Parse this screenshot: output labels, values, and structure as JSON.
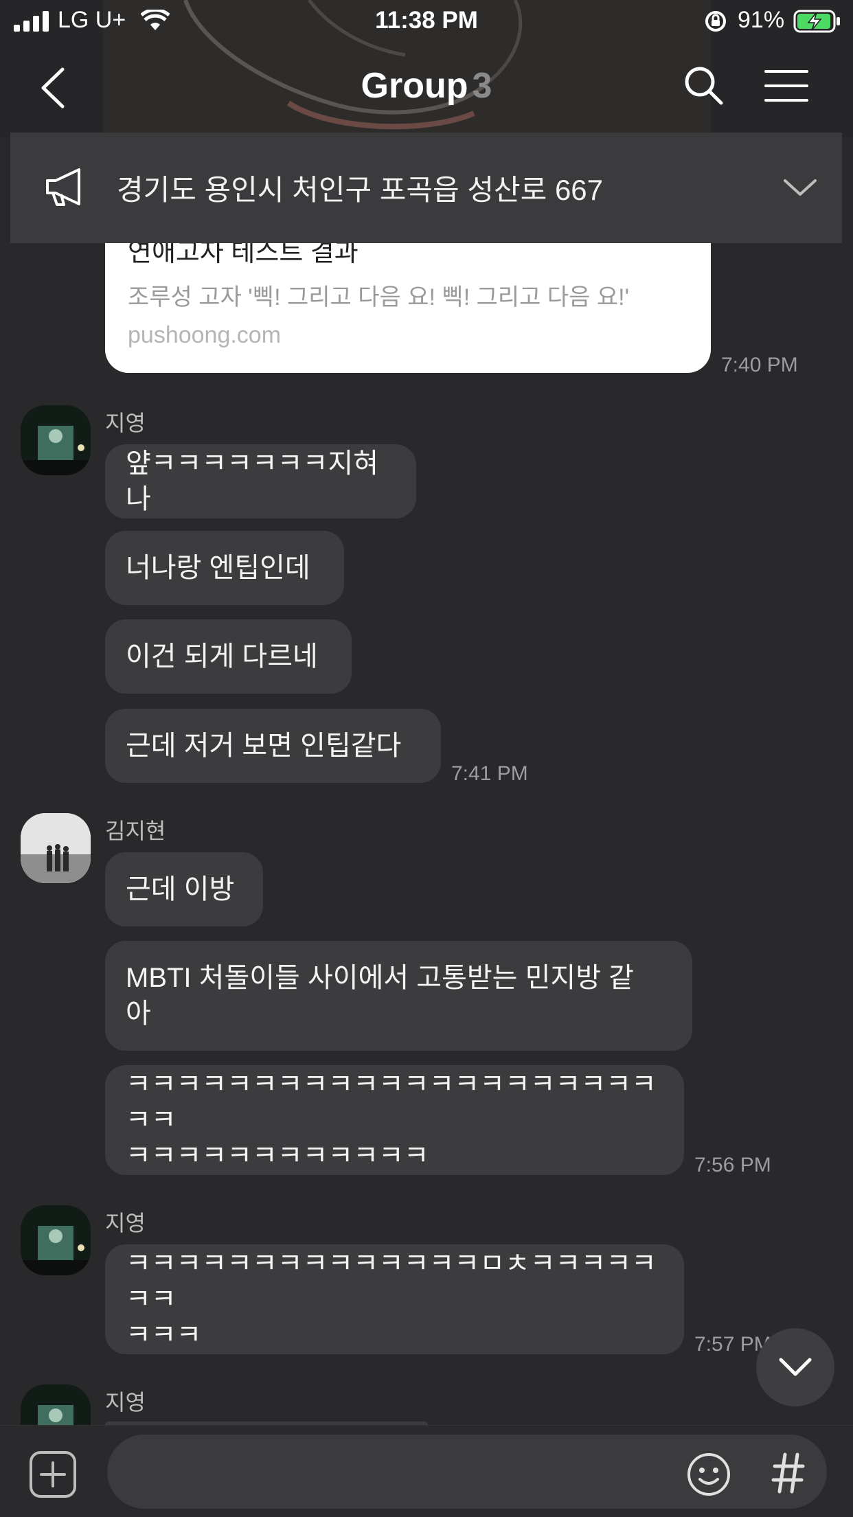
{
  "status_bar": {
    "carrier": "LG U+",
    "time": "11:38 PM",
    "battery": "91%"
  },
  "header": {
    "title": "Group",
    "member_count": "3",
    "back_icon": "chevron-left-icon",
    "search_icon": "search-icon",
    "menu_icon": "hamburger-menu-icon"
  },
  "notice": {
    "icon": "megaphone-icon",
    "text": "경기도 용인시 처인구 포곡읍 성산로 667",
    "expand_icon": "chevron-down-icon"
  },
  "link_card": {
    "title": "연애고자 테스트 결과",
    "description": "조루성 고자 '삑! 그리고 다음 요! 삑! 그리고 다음 요!'",
    "domain": "pushoong.com",
    "time": "7:40 PM"
  },
  "messages": [
    {
      "sender": "지영",
      "bubbles": [
        "얖ㅋㅋㅋㅋㅋㅋㅋ지혀나",
        "너나랑 엔팁인데",
        "이건 되게 다르네",
        "근데 저거 보면 인팁같다"
      ],
      "time": "7:41 PM"
    },
    {
      "sender": "김지현",
      "bubbles": [
        "근데 이방",
        [
          "MBTI 처돌이들 사이에서 고통받는 민지방 같",
          "아"
        ],
        [
          "ㅋㅋㅋㅋㅋㅋㅋㅋㅋㅋㅋㅋㅋㅋㅋㅋㅋㅋㅋㅋㅋㅋㅋ",
          "ㅋㅋㅋㅋㅋㅋㅋㅋㅋㅋㅋㅋ"
        ]
      ],
      "time": "7:56 PM"
    },
    {
      "sender": "지영",
      "bubbles": [
        [
          "ㅋㅋㅋㅋㅋㅋㅋㅋㅋㅋㅋㅋㅋㅋㅁㅊㅋㅋㅋㅋㅋㅋㅋ",
          "ㅋㅋㅋ"
        ]
      ],
      "time": "7:57 PM"
    },
    {
      "sender": "지영"
    }
  ],
  "input_bar": {
    "placeholder": "",
    "add_icon": "plus-square-icon",
    "emoji_icon": "emoji-icon",
    "hash_icon": "hashtag-icon"
  },
  "scroll_button": {
    "icon": "chevron-down-icon"
  },
  "colors": {
    "background": "#29292b",
    "bubble": "#3c3c3e",
    "battery_green": "#4cd964"
  }
}
